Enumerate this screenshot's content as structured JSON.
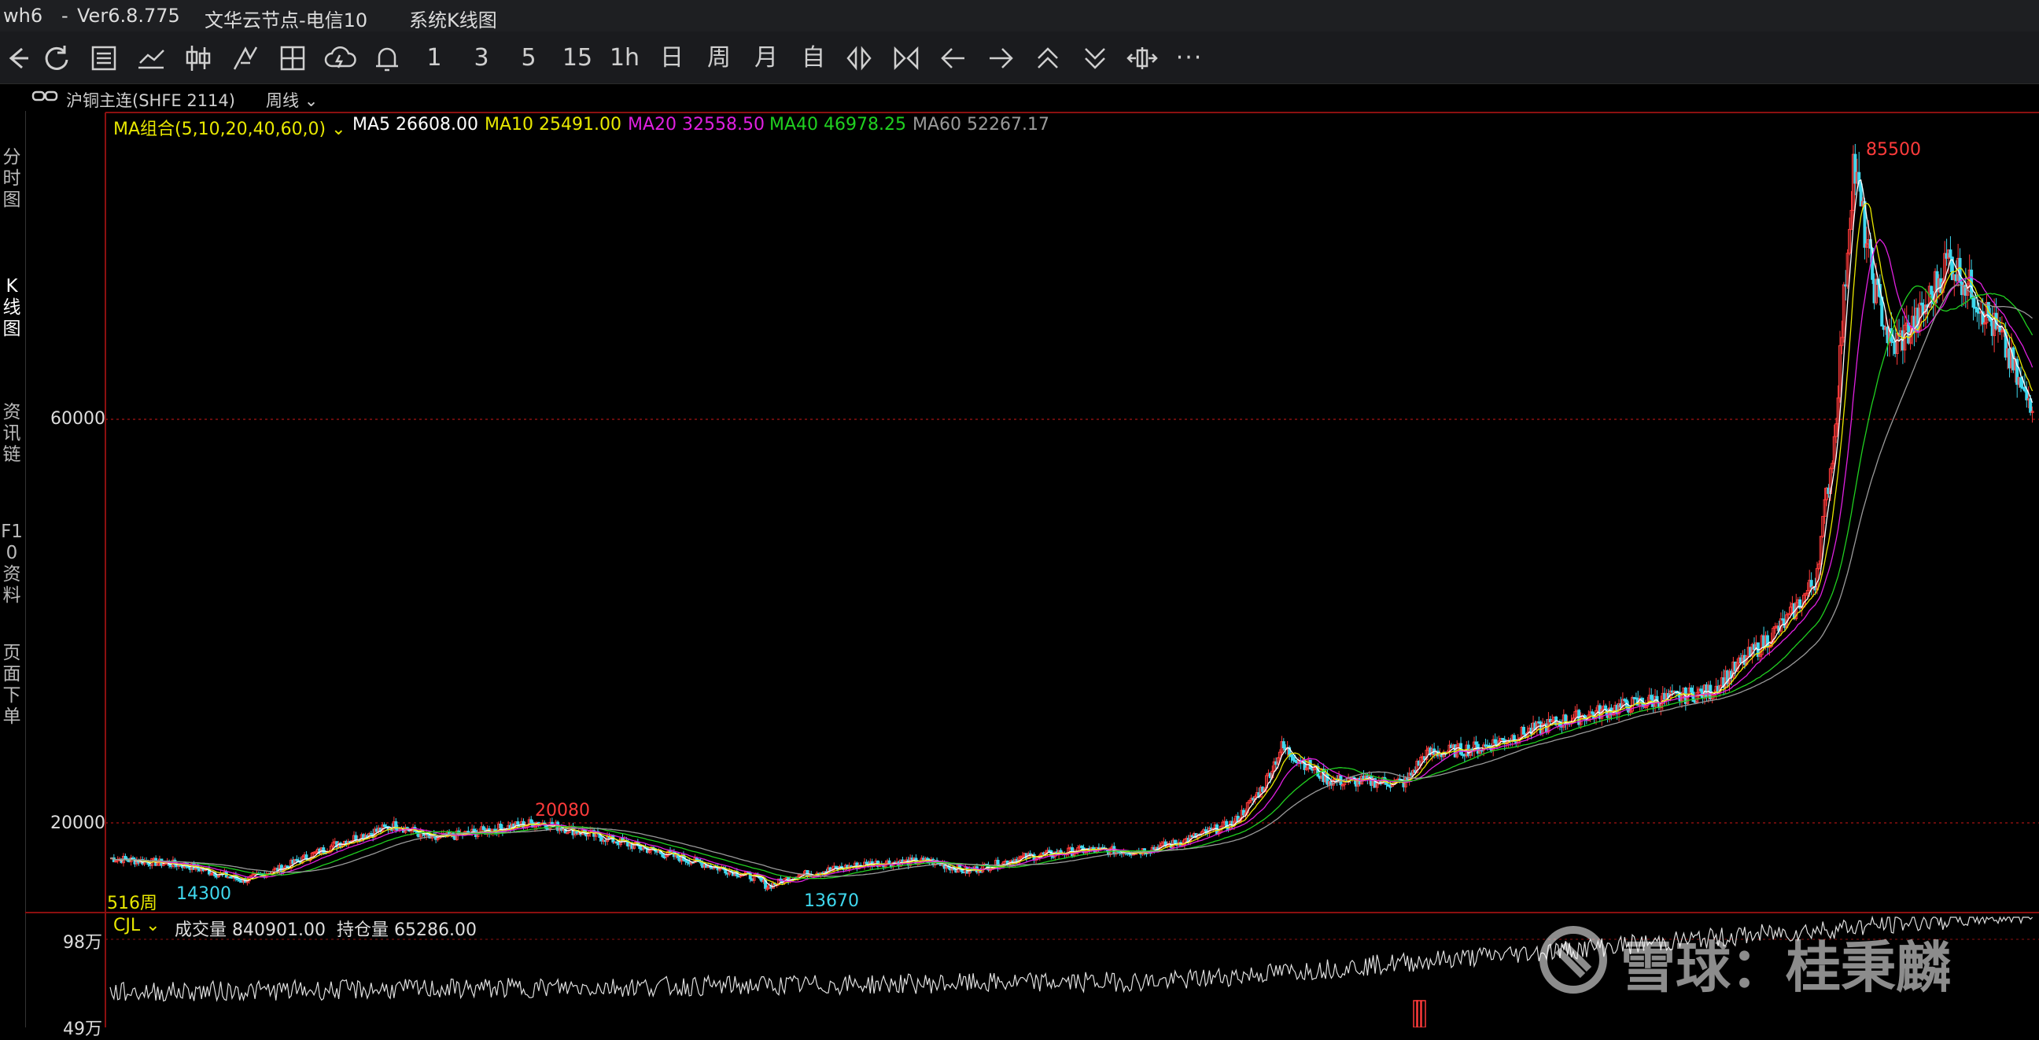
{
  "titlebar": {
    "app": "wh6",
    "sep": "-",
    "version": "Ver6.8.775",
    "server": "文华云节点-电信10",
    "view": "系统K线图"
  },
  "toolbar": {
    "periods": [
      "1",
      "3",
      "5",
      "15",
      "1h",
      "日",
      "周",
      "月",
      "自"
    ],
    "icons": [
      "back-arrow-icon",
      "refresh-icon",
      "list-icon",
      "line-chart-icon",
      "candlestick-icon",
      "draw-tool-icon",
      "panel-icon",
      "cloud-sync-icon",
      "bell-icon"
    ],
    "more_label": "···"
  },
  "symbol": {
    "name": "沪铜主连(SHFE 2114)",
    "period": "周线"
  },
  "sidetabs": [
    "分时图",
    "K线图",
    "资讯链",
    "F10资料",
    "页面下单"
  ],
  "ma_legend": {
    "group": "MA组合(5,10,20,40,60,0)",
    "ma5": "MA5 26608.00",
    "ma10": "MA10 25491.00",
    "ma20": "MA20 32558.50",
    "ma40": "MA40 46978.25",
    "ma60": "MA60 52267.17"
  },
  "price_axis": {
    "labels": [
      "60000",
      "20000"
    ]
  },
  "annotations": {
    "high": "85500",
    "mid_high": "20080",
    "low1": "14300",
    "low2": "13670",
    "bar_count": "516周"
  },
  "volume_panel": {
    "indicator": "CJL",
    "volume": "成交量 840901.00",
    "open_interest": "持仓量 65286.00",
    "axis_labels": [
      "98万",
      "49万"
    ]
  },
  "watermark": "雪球：桂秉麟",
  "colors": {
    "up": "#ff3b3b",
    "down": "#3fd8ee",
    "ma5": "#ffffff",
    "ma10": "#e8e800",
    "ma20": "#e020e0",
    "ma40": "#20d020",
    "ma60": "#9a9a9a",
    "grid": "#8b1010"
  },
  "chart_data": {
    "type": "candlestick",
    "title": "沪铜主连(SHFE 2114) 周线",
    "ylim": [
      13000,
      90000
    ],
    "price_samples": [
      [
        0,
        16500
      ],
      [
        40,
        15800
      ],
      [
        70,
        14300
      ],
      [
        90,
        15500
      ],
      [
        120,
        18000
      ],
      [
        150,
        19800
      ],
      [
        170,
        18400
      ],
      [
        190,
        19000
      ],
      [
        225,
        20080
      ],
      [
        260,
        18500
      ],
      [
        300,
        16500
      ],
      [
        340,
        14500
      ],
      [
        345,
        13670
      ],
      [
        360,
        14800
      ],
      [
        400,
        16000
      ],
      [
        430,
        16200
      ],
      [
        450,
        15200
      ],
      [
        480,
        16600
      ],
      [
        510,
        17300
      ],
      [
        540,
        17200
      ],
      [
        560,
        18000
      ],
      [
        590,
        20000
      ],
      [
        605,
        23500
      ],
      [
        615,
        27500
      ],
      [
        640,
        24200
      ],
      [
        680,
        24000
      ],
      [
        690,
        26800
      ],
      [
        720,
        27500
      ],
      [
        760,
        30000
      ],
      [
        800,
        31800
      ],
      [
        840,
        33000
      ],
      [
        880,
        40000
      ],
      [
        895,
        44000
      ],
      [
        905,
        58000
      ],
      [
        915,
        85500
      ],
      [
        925,
        74000
      ],
      [
        935,
        67000
      ],
      [
        950,
        70000
      ],
      [
        965,
        76000
      ],
      [
        980,
        72000
      ],
      [
        995,
        67000
      ],
      [
        1005,
        62000
      ]
    ],
    "volume_max": 980000
  }
}
